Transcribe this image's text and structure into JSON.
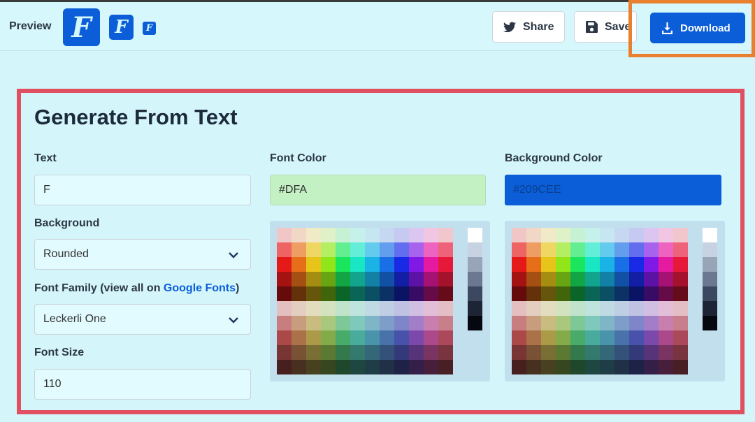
{
  "header": {
    "preview_label": "Preview",
    "favicon_letter": "F",
    "share_label": "Share",
    "save_label": "Save",
    "download_label": "Download"
  },
  "form": {
    "title": "Generate From Text",
    "text": {
      "label": "Text",
      "value": "F"
    },
    "background": {
      "label": "Background",
      "value": "Rounded"
    },
    "font_family": {
      "label": "Font Family (view all on ",
      "link": "Google Fonts",
      "suffix": ")",
      "value": "Leckerli One"
    },
    "font_size": {
      "label": "Font Size",
      "value": "110"
    },
    "font_color": {
      "label": "Font Color",
      "value": "#DFA",
      "swatch": "#c4f1c4"
    },
    "background_color": {
      "label": "Background Color",
      "value": "#209CEE",
      "swatch": "#0b5ed7"
    }
  },
  "colors": {
    "accent": "#0b5ed7",
    "page_bg": "#d4f6fb",
    "highlight_orange": "#e8802f",
    "highlight_red": "#e05060"
  },
  "icons": {
    "share": "twitter-icon",
    "save": "floppy-disk-icon",
    "download": "download-icon",
    "select": "chevron-down-icon"
  }
}
